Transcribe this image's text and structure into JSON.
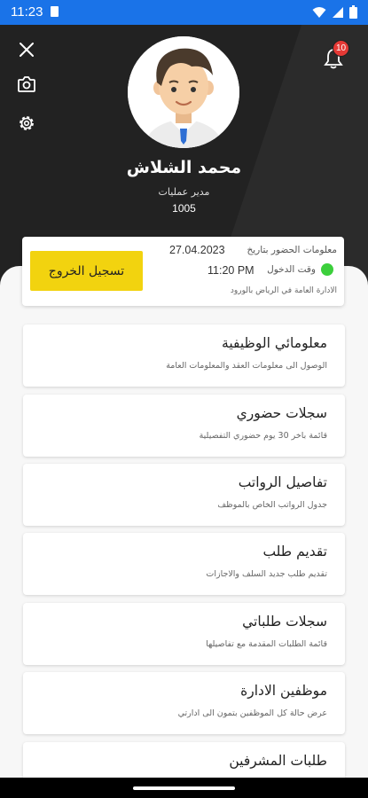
{
  "status_bar": {
    "time": "11:23"
  },
  "notifications": {
    "count": "10"
  },
  "profile": {
    "name": "محمد الشلاش",
    "job_title": "مدير عمليات",
    "employee_id": "1005"
  },
  "attendance": {
    "date_label": "معلومات الحضور بتاريخ",
    "date_value": "27.04.2023",
    "checkin_label": "وقت الدخول",
    "checkin_time": "11:20 PM",
    "location": "الادارة العامة في الرياض بالورود",
    "status_color": "#3ccf3c",
    "logout_label": "تسجيل الخروج"
  },
  "menu": [
    {
      "title": "معلومائي الوظيفية",
      "subtitle": "الوصول الى معلومات العقد والمعلومات العامة"
    },
    {
      "title": "سجلات حضوري",
      "subtitle": "قائمة باخر 30 يوم حضوري التفصيلية"
    },
    {
      "title": "تفاصيل الرواتب",
      "subtitle": "جدول الرواتب الخاص بالموظف"
    },
    {
      "title": "تقديم طلب",
      "subtitle": "تقديم طلب جديد السلف والاجازات"
    },
    {
      "title": "سجلات طلباتي",
      "subtitle": "قائمة الطلبات المقدمة مع تفاصيلها"
    },
    {
      "title": "موظفين الادارة",
      "subtitle": "عرض حالة كل الموظفين بتمون الى ادارتي"
    },
    {
      "title": "طلبات المشرفين",
      "subtitle": ""
    }
  ],
  "colors": {
    "accent": "#f2d30f",
    "header": "#222222",
    "status_bar": "#1a73e8",
    "badge": "#e53935"
  }
}
